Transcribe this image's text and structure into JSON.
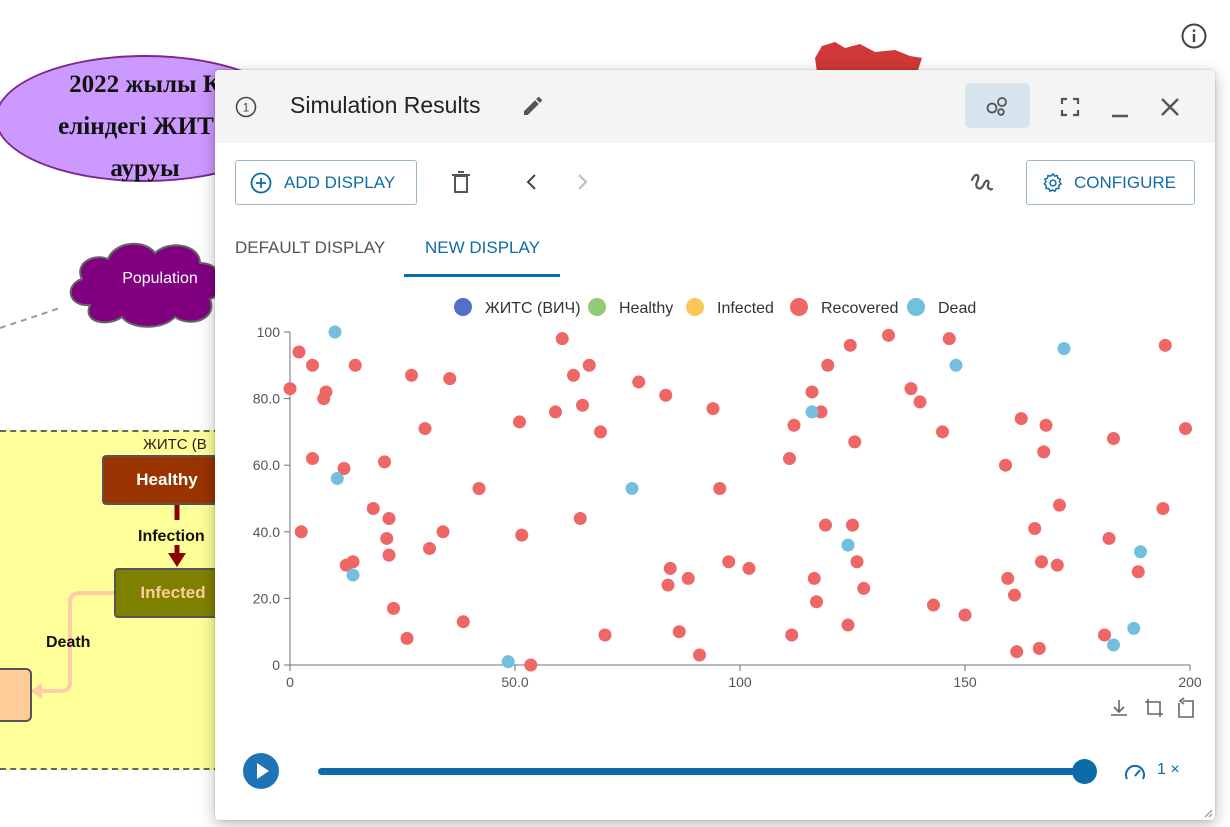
{
  "canvas": {
    "ellipse_lines": [
      "2022 жылы К",
      "еліндегі ЖИТС",
      "ауруы"
    ],
    "cloud_label": "Population",
    "zone_label": "ЖИТС (В",
    "nodes": {
      "healthy": "Healthy",
      "infected": "Infected"
    },
    "edges": {
      "infection": "Infection",
      "death": "Death"
    },
    "info_icon": "info-circle-icon"
  },
  "window": {
    "number": "1",
    "title": "Simulation Results",
    "toolbar": {
      "add_display": "ADD DISPLAY",
      "configure": "CONFIGURE"
    },
    "tabs": [
      {
        "label": "DEFAULT DISPLAY",
        "active": false
      },
      {
        "label": "NEW DISPLAY",
        "active": true
      }
    ],
    "playback": {
      "speed": "1 ×",
      "progress": 1.0
    }
  },
  "colors": {
    "accent": "#0f6ba8",
    "series": [
      "#5470c6",
      "#91cc75",
      "#fac858",
      "#ee6666",
      "#73c0de"
    ]
  },
  "chart_data": {
    "type": "scatter",
    "legend_position": "top-center",
    "xlim": [
      0,
      200
    ],
    "ylim": [
      0,
      100
    ],
    "x_ticks": [
      "0",
      "50.0",
      "100",
      "150",
      "200"
    ],
    "y_ticks": [
      "0",
      "20.0",
      "40.0",
      "60.0",
      "80.0",
      "100"
    ],
    "series": [
      {
        "name": "ЖИТС (ВИЧ)",
        "color": "#5470c6",
        "points": []
      },
      {
        "name": "Healthy",
        "color": "#91cc75",
        "points": []
      },
      {
        "name": "Infected",
        "color": "#fac858",
        "points": []
      },
      {
        "name": "Recovered",
        "color": "#ee6666",
        "points": [
          [
            0,
            83
          ],
          [
            2,
            94
          ],
          [
            2.5,
            40
          ],
          [
            5,
            62
          ],
          [
            5,
            90
          ],
          [
            7.5,
            80
          ],
          [
            8,
            82
          ],
          [
            12,
            59
          ],
          [
            12.5,
            30
          ],
          [
            14,
            31
          ],
          [
            14.5,
            90
          ],
          [
            18.5,
            47
          ],
          [
            21,
            61
          ],
          [
            21.5,
            38
          ],
          [
            22,
            44
          ],
          [
            22,
            33
          ],
          [
            23,
            17
          ],
          [
            26,
            8
          ],
          [
            27,
            87
          ],
          [
            30,
            71
          ],
          [
            31,
            35
          ],
          [
            34,
            40
          ],
          [
            35.5,
            86
          ],
          [
            38.5,
            13
          ],
          [
            42,
            53
          ],
          [
            51,
            73
          ],
          [
            51.5,
            39
          ],
          [
            53.5,
            0
          ],
          [
            59,
            76
          ],
          [
            60.5,
            98
          ],
          [
            63,
            87
          ],
          [
            64.5,
            44
          ],
          [
            65,
            78
          ],
          [
            66.5,
            90
          ],
          [
            69,
            70
          ],
          [
            70,
            9
          ],
          [
            77.5,
            85
          ],
          [
            83.5,
            81
          ],
          [
            84,
            24
          ],
          [
            84.5,
            29
          ],
          [
            86.5,
            10
          ],
          [
            88.5,
            26
          ],
          [
            91,
            3
          ],
          [
            94,
            77
          ],
          [
            95.5,
            53
          ],
          [
            97.5,
            31
          ],
          [
            102,
            29
          ],
          [
            111,
            62
          ],
          [
            111.5,
            9
          ],
          [
            112,
            72
          ],
          [
            116,
            82
          ],
          [
            116.5,
            26
          ],
          [
            117,
            19
          ],
          [
            118,
            76
          ],
          [
            119,
            42
          ],
          [
            119.5,
            90
          ],
          [
            124,
            12
          ],
          [
            124.5,
            96
          ],
          [
            125,
            42
          ],
          [
            125.5,
            67
          ],
          [
            126,
            31
          ],
          [
            127.5,
            23
          ],
          [
            133,
            99
          ],
          [
            138,
            83
          ],
          [
            140,
            79
          ],
          [
            143,
            18
          ],
          [
            145,
            70
          ],
          [
            146.5,
            98
          ],
          [
            150,
            15
          ],
          [
            159,
            60
          ],
          [
            159.5,
            26
          ],
          [
            161,
            21
          ],
          [
            161.5,
            4
          ],
          [
            162.5,
            74
          ],
          [
            165.5,
            41
          ],
          [
            166.5,
            5
          ],
          [
            167,
            31
          ],
          [
            167.5,
            64
          ],
          [
            168,
            72
          ],
          [
            170.5,
            30
          ],
          [
            171,
            48
          ],
          [
            181,
            9
          ],
          [
            182,
            38
          ],
          [
            183,
            68
          ],
          [
            188.5,
            28
          ],
          [
            194,
            47
          ],
          [
            194.5,
            96
          ],
          [
            199,
            71
          ]
        ]
      },
      {
        "name": "Dead",
        "color": "#73c0de",
        "points": [
          [
            10,
            100
          ],
          [
            10.5,
            56
          ],
          [
            14,
            27
          ],
          [
            48.5,
            1
          ],
          [
            76,
            53
          ],
          [
            116,
            76
          ],
          [
            124,
            36
          ],
          [
            148,
            90
          ],
          [
            172,
            95
          ],
          [
            183,
            6
          ],
          [
            187.5,
            11
          ],
          [
            189,
            34
          ]
        ]
      }
    ]
  }
}
